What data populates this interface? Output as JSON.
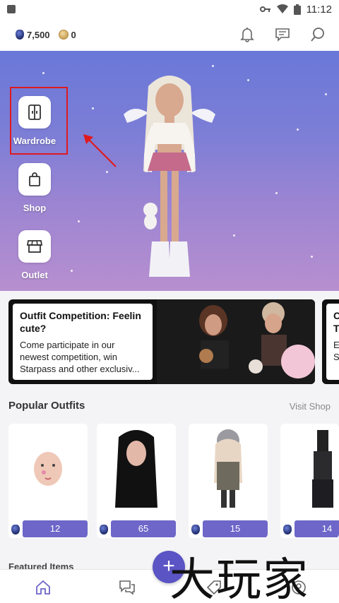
{
  "status_bar": {
    "time": "11:12"
  },
  "currencies": {
    "gems": "7,500",
    "coins": "0"
  },
  "hero": {
    "buttons": [
      {
        "label": "Wardrobe",
        "icon": "wardrobe-icon"
      },
      {
        "label": "Shop",
        "icon": "shopping-bag-icon"
      },
      {
        "label": "Outlet",
        "icon": "storefront-icon"
      }
    ]
  },
  "banners": [
    {
      "title": "Outfit Competition: Feelin cute?",
      "description": "Come participate in our newest competition, win Starpass and other exclusiv..."
    },
    {
      "title": "C T",
      "description": "E\nS"
    }
  ],
  "popular_outfits": {
    "title": "Popular Outfits",
    "link": "Visit Shop",
    "items": [
      {
        "price": "12"
      },
      {
        "price": "65"
      },
      {
        "price": "15"
      },
      {
        "price": "14"
      }
    ]
  },
  "featured": {
    "title": "Featured Items"
  },
  "bottom_nav": [
    "home-icon",
    "chat-icon",
    "tag-icon",
    "profile-icon"
  ],
  "watermark": "大玩家",
  "colors": {
    "accent": "#6e66c8",
    "fab": "#5a54c4",
    "highlight": "#e0191f"
  }
}
